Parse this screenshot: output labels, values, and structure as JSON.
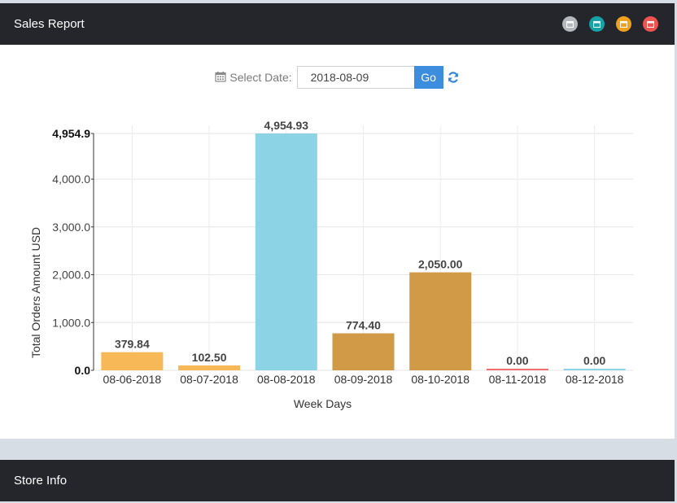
{
  "sales_panel": {
    "title": "Sales Report",
    "header_icons": [
      {
        "name": "calendar-gray-icon",
        "color": "#b5b8bd"
      },
      {
        "name": "calendar-teal-icon",
        "color": "#17a2a8"
      },
      {
        "name": "calendar-orange-icon",
        "color": "#f0a21d"
      },
      {
        "name": "calendar-red-icon",
        "color": "#ef5350"
      }
    ]
  },
  "date_filter": {
    "label": "Select Date:",
    "value": "2018-08-09",
    "go_label": "Go"
  },
  "store_panel": {
    "title": "Store Info"
  },
  "chart_data": {
    "type": "bar",
    "categories": [
      "08-06-2018",
      "08-07-2018",
      "08-08-2018",
      "08-09-2018",
      "08-10-2018",
      "08-11-2018",
      "08-12-2018"
    ],
    "values": [
      379.84,
      102.5,
      4954.93,
      774.4,
      2050.0,
      0.0,
      0.0
    ],
    "value_labels": [
      "379.84",
      "102.50",
      "4,954.93",
      "774.40",
      "2,050.00",
      "0.00",
      "0.00"
    ],
    "colors": [
      "#f7b957",
      "#f7b957",
      "#8cd3e5",
      "#d19a47",
      "#d19a47",
      "#ef6f6f",
      "#8cd3e5"
    ],
    "xlabel": "Week Days",
    "ylabel": "Total Orders Amount USD",
    "yticks": [
      "0.0",
      "1,000.0",
      "2,000.0",
      "3,000.0",
      "4,000.0",
      "4,954.9"
    ],
    "ytick_values": [
      0,
      1000,
      2000,
      3000,
      4000,
      4954.93
    ],
    "ylim": [
      0,
      4954.93
    ],
    "grid": true
  }
}
